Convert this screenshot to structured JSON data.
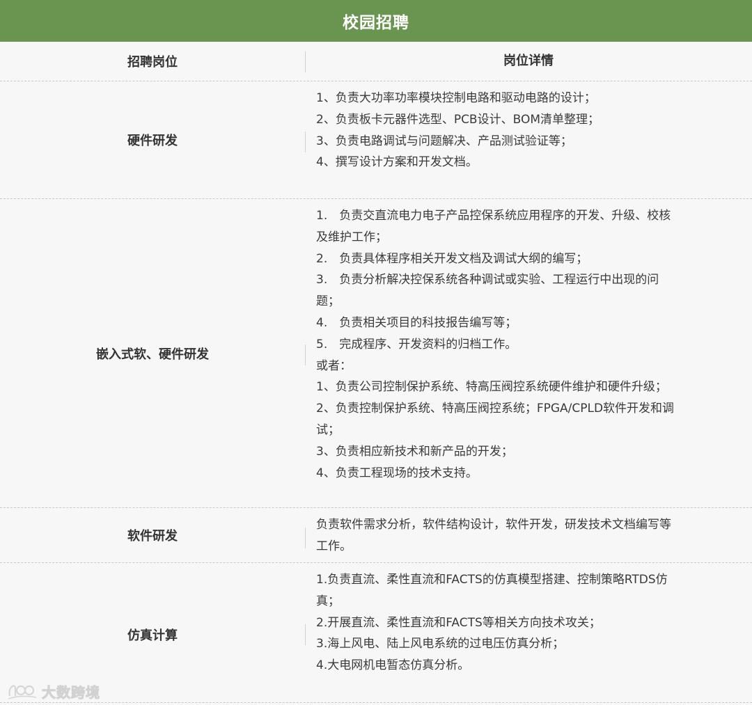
{
  "title": "校园招聘",
  "header": {
    "position": "招聘岗位",
    "details": "岗位详情"
  },
  "rows": [
    {
      "position": "硬件研发",
      "lines": [
        "1、负责大功率功率模块控制电路和驱动电路的设计；",
        "2、负责板卡元器件选型、PCB设计、BOM清单整理；",
        "3、负责电路调试与问题解决、产品测试验证等；",
        "4、撰写设计方案和开发文档。"
      ]
    },
    {
      "position": "嵌入式软、硬件研发",
      "lines": [
        "1.　负责交直流电力电子产品控保系统应用程序的开发、升级、校核",
        "及维护工作；",
        "2.　负责具体程序相关开发文档及调试大纲的编写；",
        "3.　负责分析解决控保系统各种调试或实验、工程运行中出现的问",
        "题；",
        "4.　负责相关项目的科技报告编写等；",
        "5.　完成程序、开发资料的归档工作。",
        "或者：",
        "1、负责公司控制保护系统、特高压阀控系统硬件维护和硬件升级；",
        "2、负责控制保护系统、特高压阀控系统；FPGA/CPLD软件开发和调",
        "试；",
        "3、负责相应新技术和新产品的开发；",
        "4、负责工程现场的技术支持。"
      ]
    },
    {
      "position": "软件研发",
      "lines": [
        "负责软件需求分析，软件结构设计，软件开发，研发技术文档编写等",
        "工作。"
      ]
    },
    {
      "position": "仿真计算",
      "lines": [
        "1.负责直流、柔性直流和FACTS的仿真模型搭建、控制策略RTDS仿",
        "真；",
        "2.开展直流、柔性直流和FACTS等相关方向技术攻关；",
        "3.海上风电、陆上风电系统的过电压仿真分析；",
        "4.大电网机电暂态仿真分析。"
      ]
    }
  ],
  "watermark": "大数跨境",
  "colors": {
    "title_bar": "#6a9550",
    "background": "#f7f7f7"
  }
}
